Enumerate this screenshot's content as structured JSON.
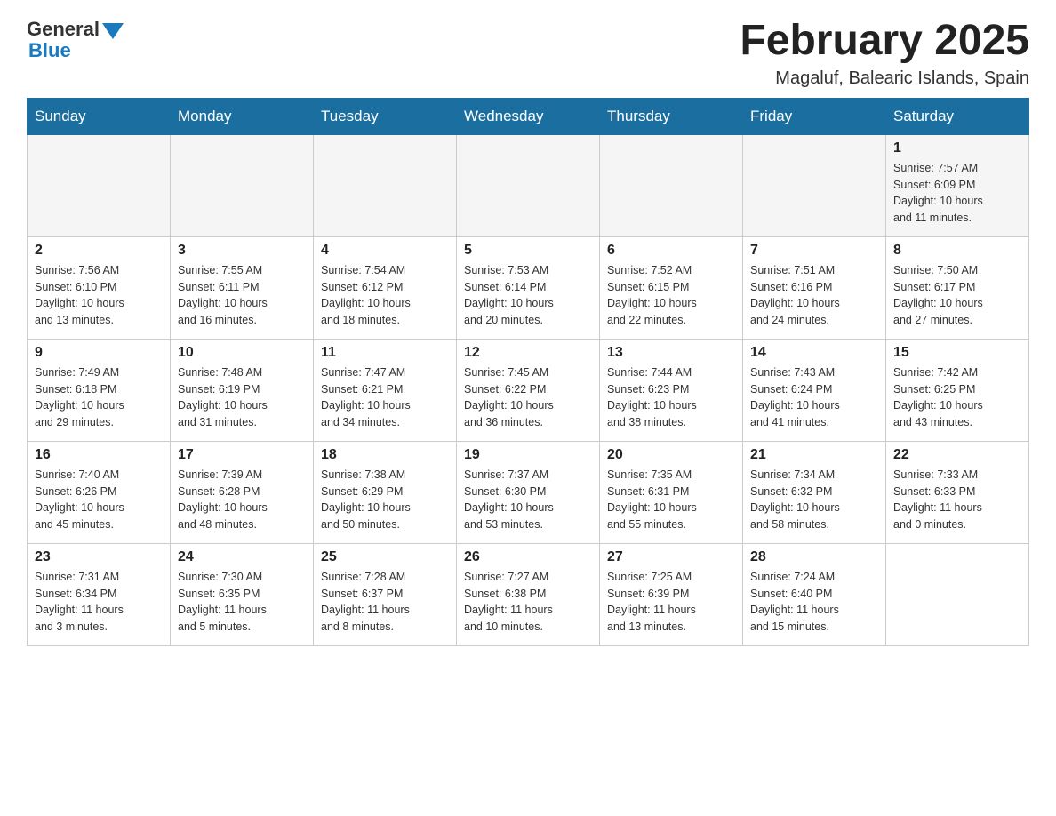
{
  "header": {
    "logo_general": "General",
    "logo_blue": "Blue",
    "month_title": "February 2025",
    "subtitle": "Magaluf, Balearic Islands, Spain"
  },
  "weekdays": [
    "Sunday",
    "Monday",
    "Tuesday",
    "Wednesday",
    "Thursday",
    "Friday",
    "Saturday"
  ],
  "weeks": [
    [
      {
        "day": "",
        "info": ""
      },
      {
        "day": "",
        "info": ""
      },
      {
        "day": "",
        "info": ""
      },
      {
        "day": "",
        "info": ""
      },
      {
        "day": "",
        "info": ""
      },
      {
        "day": "",
        "info": ""
      },
      {
        "day": "1",
        "info": "Sunrise: 7:57 AM\nSunset: 6:09 PM\nDaylight: 10 hours\nand 11 minutes."
      }
    ],
    [
      {
        "day": "2",
        "info": "Sunrise: 7:56 AM\nSunset: 6:10 PM\nDaylight: 10 hours\nand 13 minutes."
      },
      {
        "day": "3",
        "info": "Sunrise: 7:55 AM\nSunset: 6:11 PM\nDaylight: 10 hours\nand 16 minutes."
      },
      {
        "day": "4",
        "info": "Sunrise: 7:54 AM\nSunset: 6:12 PM\nDaylight: 10 hours\nand 18 minutes."
      },
      {
        "day": "5",
        "info": "Sunrise: 7:53 AM\nSunset: 6:14 PM\nDaylight: 10 hours\nand 20 minutes."
      },
      {
        "day": "6",
        "info": "Sunrise: 7:52 AM\nSunset: 6:15 PM\nDaylight: 10 hours\nand 22 minutes."
      },
      {
        "day": "7",
        "info": "Sunrise: 7:51 AM\nSunset: 6:16 PM\nDaylight: 10 hours\nand 24 minutes."
      },
      {
        "day": "8",
        "info": "Sunrise: 7:50 AM\nSunset: 6:17 PM\nDaylight: 10 hours\nand 27 minutes."
      }
    ],
    [
      {
        "day": "9",
        "info": "Sunrise: 7:49 AM\nSunset: 6:18 PM\nDaylight: 10 hours\nand 29 minutes."
      },
      {
        "day": "10",
        "info": "Sunrise: 7:48 AM\nSunset: 6:19 PM\nDaylight: 10 hours\nand 31 minutes."
      },
      {
        "day": "11",
        "info": "Sunrise: 7:47 AM\nSunset: 6:21 PM\nDaylight: 10 hours\nand 34 minutes."
      },
      {
        "day": "12",
        "info": "Sunrise: 7:45 AM\nSunset: 6:22 PM\nDaylight: 10 hours\nand 36 minutes."
      },
      {
        "day": "13",
        "info": "Sunrise: 7:44 AM\nSunset: 6:23 PM\nDaylight: 10 hours\nand 38 minutes."
      },
      {
        "day": "14",
        "info": "Sunrise: 7:43 AM\nSunset: 6:24 PM\nDaylight: 10 hours\nand 41 minutes."
      },
      {
        "day": "15",
        "info": "Sunrise: 7:42 AM\nSunset: 6:25 PM\nDaylight: 10 hours\nand 43 minutes."
      }
    ],
    [
      {
        "day": "16",
        "info": "Sunrise: 7:40 AM\nSunset: 6:26 PM\nDaylight: 10 hours\nand 45 minutes."
      },
      {
        "day": "17",
        "info": "Sunrise: 7:39 AM\nSunset: 6:28 PM\nDaylight: 10 hours\nand 48 minutes."
      },
      {
        "day": "18",
        "info": "Sunrise: 7:38 AM\nSunset: 6:29 PM\nDaylight: 10 hours\nand 50 minutes."
      },
      {
        "day": "19",
        "info": "Sunrise: 7:37 AM\nSunset: 6:30 PM\nDaylight: 10 hours\nand 53 minutes."
      },
      {
        "day": "20",
        "info": "Sunrise: 7:35 AM\nSunset: 6:31 PM\nDaylight: 10 hours\nand 55 minutes."
      },
      {
        "day": "21",
        "info": "Sunrise: 7:34 AM\nSunset: 6:32 PM\nDaylight: 10 hours\nand 58 minutes."
      },
      {
        "day": "22",
        "info": "Sunrise: 7:33 AM\nSunset: 6:33 PM\nDaylight: 11 hours\nand 0 minutes."
      }
    ],
    [
      {
        "day": "23",
        "info": "Sunrise: 7:31 AM\nSunset: 6:34 PM\nDaylight: 11 hours\nand 3 minutes."
      },
      {
        "day": "24",
        "info": "Sunrise: 7:30 AM\nSunset: 6:35 PM\nDaylight: 11 hours\nand 5 minutes."
      },
      {
        "day": "25",
        "info": "Sunrise: 7:28 AM\nSunset: 6:37 PM\nDaylight: 11 hours\nand 8 minutes."
      },
      {
        "day": "26",
        "info": "Sunrise: 7:27 AM\nSunset: 6:38 PM\nDaylight: 11 hours\nand 10 minutes."
      },
      {
        "day": "27",
        "info": "Sunrise: 7:25 AM\nSunset: 6:39 PM\nDaylight: 11 hours\nand 13 minutes."
      },
      {
        "day": "28",
        "info": "Sunrise: 7:24 AM\nSunset: 6:40 PM\nDaylight: 11 hours\nand 15 minutes."
      },
      {
        "day": "",
        "info": ""
      }
    ]
  ]
}
